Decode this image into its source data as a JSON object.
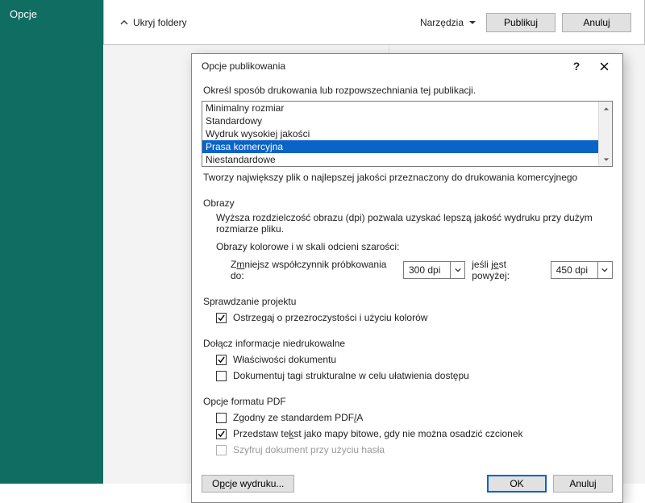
{
  "leftRail": {
    "opcje": "Opcje"
  },
  "backPanel": {
    "ukryj": "Ukryj foldery",
    "narzedzia": "Narzędzia",
    "publikuj": "Publikuj",
    "anuluj": "Anuluj"
  },
  "dialog": {
    "title": "Opcje publikowania",
    "help": "?",
    "prompt": "Określ sposób drukowania lub rozpowszechniania tej publikacji.",
    "listItems": [
      "Minimalny rozmiar",
      "Standardowy",
      "Wydruk wysokiej jakości",
      "Prasa komercyjna",
      "Niestandardowe"
    ],
    "listSelectedIndex": 3,
    "desc": "Tworzy największy plik o najlepszej jakości przeznaczony do drukowania komercyjnego",
    "obrazy": {
      "header": "Obrazy",
      "intro": "Wyższa rozdzielczość obrazu (dpi) pozwala uzyskać lepszą jakość wydruku przy dużym rozmiarze pliku.",
      "kolor": "Obrazy kolorowe i w skali odcieni szarości:",
      "zmniejsz_pre": "Z",
      "zmniejsz_post": "mniejsz współczynnik próbkowania do:",
      "downsample": "300 dpi",
      "jesli_pre": "jeśli j",
      "jesli_u": "e",
      "jesli_post": "st powyżej:",
      "above": "450 dpi"
    },
    "projekt": {
      "header": "Sprawdzanie projektu",
      "ostrzegaj": "Ostrzegaj o przezroczystości i użyciu kolorów"
    },
    "niedruk": {
      "header": "Dołącz informacje niedrukowalne",
      "wlasciwosci": "Właściwości dokumentu",
      "tagi": "Dokumentuj tagi strukturalne w celu ułatwienia dostępu"
    },
    "pdf": {
      "header": "Opcje formatu PDF",
      "pdfa_pre": "Zgodny ze standardem PDF",
      "pdfa_u": "/",
      "pdfa_post": "A",
      "tekst_pre": "Przedstaw te",
      "tekst_u": "k",
      "tekst_post": "st jako mapy bitowe, gdy nie można osadzić czcionek",
      "szyfruj": "Szyfruj dokument przy użyciu hasła"
    },
    "footer": {
      "opcje_pre": "O",
      "opcje_u": "p",
      "opcje_post": "cje wydruku...",
      "ok": "OK",
      "anuluj": "Anuluj"
    }
  }
}
